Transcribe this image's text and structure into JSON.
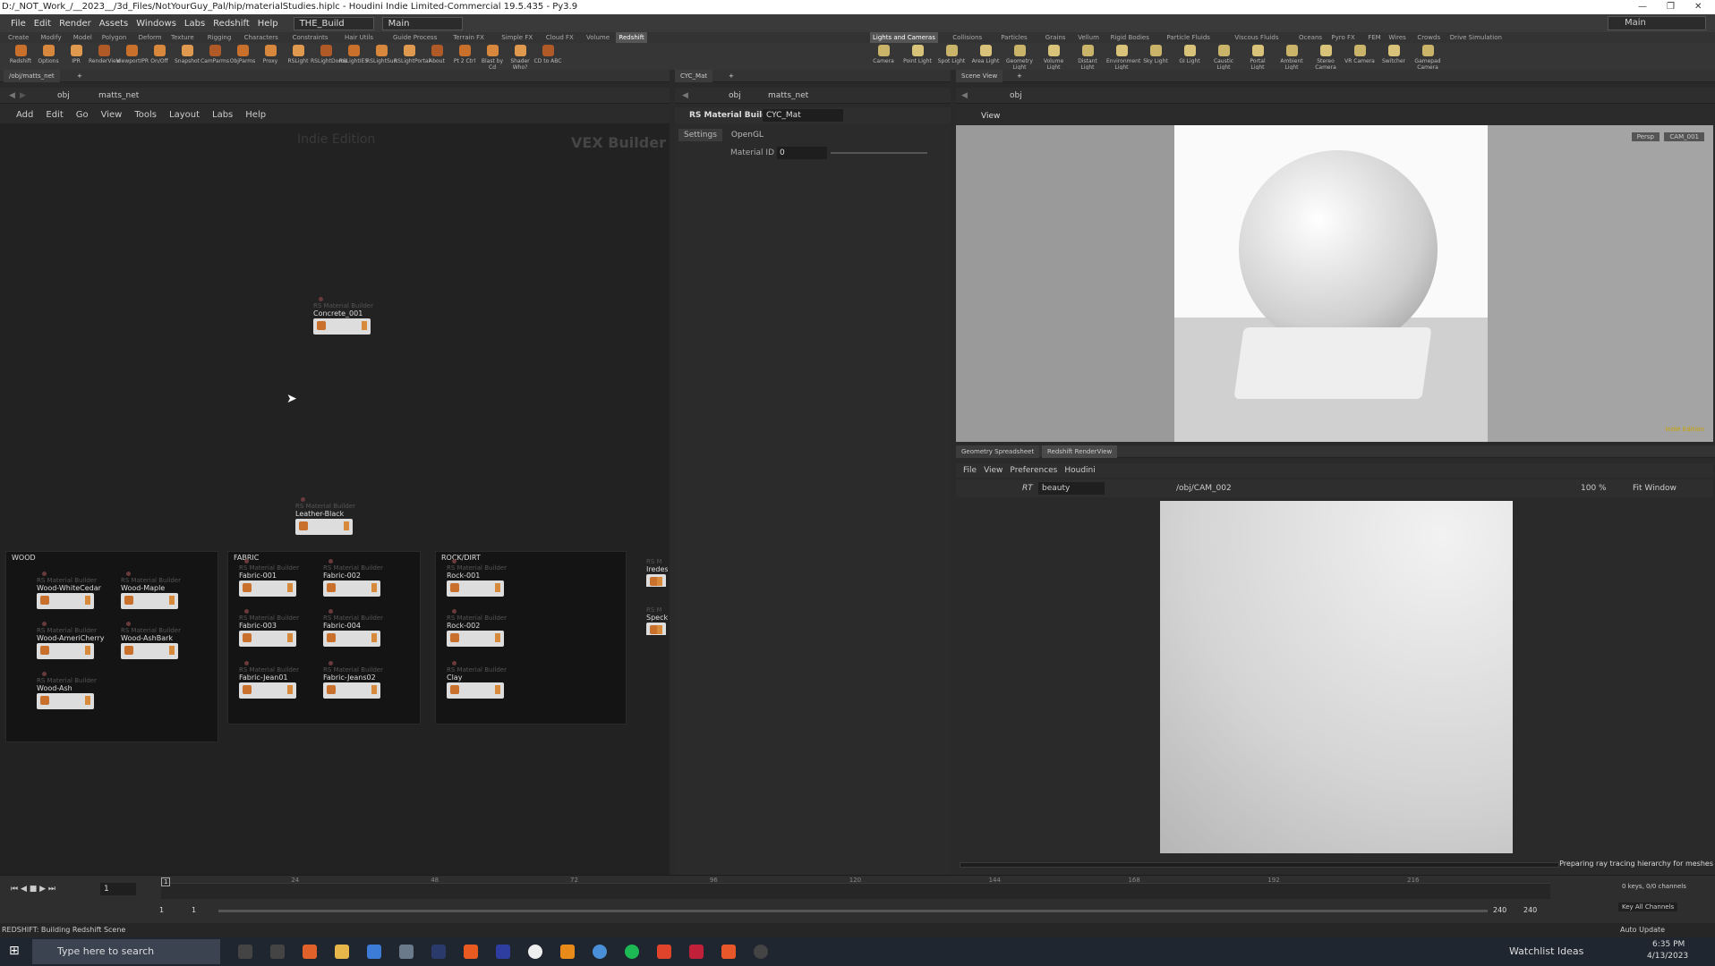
{
  "window": {
    "title": "D:/_NOT_Work_/__2023__/3d_Files/NotYourGuy_Pal/hip/materialStudies.hiplc - Houdini Indie Limited-Commercial 19.5.435 - Py3.9"
  },
  "menubar": {
    "items": [
      "File",
      "Edit",
      "Render",
      "Assets",
      "Windows",
      "Labs",
      "Redshift",
      "Help"
    ],
    "build": "THE_Build",
    "main": "Main"
  },
  "desktop": "Main",
  "shelf_tabs_left": [
    "Create",
    "Modify",
    "Model",
    "Polygon",
    "Deform",
    "Texture",
    "Rigging",
    "Characters",
    "Constraints",
    "Hair Utils",
    "Guide Process",
    "Terrain FX",
    "Simple FX",
    "Cloud FX",
    "Volume",
    "Redshift"
  ],
  "shelf_tabs_right": [
    "Lights and Cameras",
    "Collisions",
    "Particles",
    "Grains",
    "Vellum",
    "Rigid Bodies",
    "Particle Fluids",
    "Viscous Fluids",
    "Oceans",
    "Pyro FX",
    "FEM",
    "Wires",
    "Crowds",
    "Drive Simulation"
  ],
  "tools_left": [
    "Redshift",
    "Options",
    "IPR",
    "RenderView",
    "ViewportIPR",
    "On/Off",
    "Snapshot",
    "CamParms",
    "ObjParms",
    "Proxy",
    "RSLight",
    "RSLightDome",
    "RSLightIES",
    "RSLightSun",
    "RSLightPortal",
    "About",
    "Pt 2 Ctrl",
    "Blast by Cd",
    "Shader Who?",
    "CD to ABC"
  ],
  "tools_right": [
    "Camera",
    "Point Light",
    "Spot Light",
    "Area Light",
    "Geometry Light",
    "Volume Light",
    "Distant Light",
    "Environment Light",
    "Sky Light",
    "GI Light",
    "Caustic Light",
    "Portal Light",
    "Ambient Light",
    "Stereo Camera",
    "VR Camera",
    "Switcher",
    "Gamepad Camera"
  ],
  "network": {
    "tab": "/obj/matts_net",
    "path_obj": "obj",
    "path_net": "matts_net",
    "menu": [
      "Add",
      "Edit",
      "Go",
      "View",
      "Tools",
      "Layout",
      "Labs",
      "Help"
    ],
    "watermark1": "Indie Edition",
    "watermark2": "VEX Builder"
  },
  "nodes": {
    "type": "RS Material Builder",
    "concrete": "Concrete_001",
    "leather": "Leather-Black",
    "wood_title": "WOOD",
    "wood": [
      "Wood-WhiteCedar",
      "Wood-Maple",
      "Wood-AmeriCherry",
      "Wood-AshBark",
      "Wood-Ash"
    ],
    "fabric_title": "FABRIC",
    "fabric": [
      "Fabric-001",
      "Fabric-002",
      "Fabric-003",
      "Fabric-004",
      "Fabric-Jean01",
      "Fabric-Jeans02"
    ],
    "rock_title": "ROCK/DIRT",
    "rock": [
      "Rock-001",
      "Rock-002",
      "Clay"
    ],
    "partial": [
      "Iredes",
      "Speck"
    ],
    "partial_type": "RS M"
  },
  "params": {
    "tab": "CYC_Mat",
    "path_obj": "obj",
    "path_net": "matts_net",
    "node_type": "RS Material Builder",
    "node_name": "CYC_Mat",
    "tabs": [
      "Settings",
      "OpenGL"
    ],
    "material_id_label": "Material ID",
    "material_id_value": "0"
  },
  "scene": {
    "tab": "Scene View",
    "path": "obj",
    "view_label": "View",
    "persp": "Persp",
    "cam": "CAM_001",
    "indie": "Indie Edition"
  },
  "render": {
    "tabs": [
      "Geometry Spreadsheet",
      "Redshift RenderView"
    ],
    "menu": [
      "File",
      "View",
      "Preferences",
      "Houdini"
    ],
    "rt": "RT",
    "aov": "beauty",
    "camera": "/obj/CAM_002",
    "zoom": "100 %",
    "fit": "Fit Window",
    "status": "Preparing ray tracing hierarchy for meshes"
  },
  "timeline": {
    "frame": "1",
    "marks": [
      "24",
      "48",
      "72",
      "96",
      "120",
      "144",
      "168",
      "192",
      "216"
    ],
    "range_start": "1",
    "range_start2": "1",
    "range_end": "240",
    "range_end2": "240",
    "keys": "0 keys, 0/0 channels",
    "keyall": "Key All Channels",
    "autoupdate": "Auto Update",
    "cur_marker": "1"
  },
  "status": "REDSHIFT: Building Redshift Scene",
  "taskbar": {
    "search": "Type here to search",
    "watch": "Watchlist Ideas",
    "time": "6:35 PM",
    "date": "4/13/2023"
  }
}
